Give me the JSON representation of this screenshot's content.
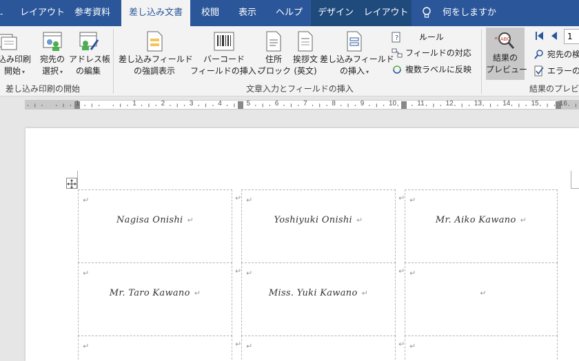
{
  "tabs": {
    "layout1": "レイアウト",
    "references": "参考資料",
    "mailings": "差し込み文書",
    "review": "校閲",
    "view": "表示",
    "help": "ヘルプ",
    "design": "デザイン",
    "layout2": "レイアウト",
    "tell_me": "何をしますか"
  },
  "ribbon": {
    "start_merge": {
      "line1": "込み印刷",
      "line2": "開始"
    },
    "select_recipients": {
      "line1": "宛先の",
      "line2": "選択"
    },
    "edit_address": {
      "line1": "アドレス帳",
      "line2": "の編集"
    },
    "group_start": "差し込み印刷の開始",
    "highlight_fields": {
      "line1": "差し込みフィールド",
      "line2": "の強調表示"
    },
    "barcode": {
      "line1": "バーコード",
      "line2": "フィールドの挿入"
    },
    "address_block": {
      "line1": "住所",
      "line2": "ブロック"
    },
    "greeting": {
      "line1": "挨拶文",
      "line2": "(英文)"
    },
    "insert_field": {
      "line1": "差し込みフィールド",
      "line2": "の挿入"
    },
    "rules": "ルール",
    "match_fields": "フィールドの対応",
    "update_labels": "複数ラベルに反映",
    "group_write": "文章入力とフィールドの挿入",
    "preview": {
      "line1": "結果の",
      "line2": "プレビュー"
    },
    "record_number": "1",
    "find_recipient": "宛先の検",
    "check_errors": "エラーのチ",
    "group_preview": "結果のプレビュ"
  },
  "ruler_numbers": [
    "1",
    "1",
    "2",
    "3",
    "4",
    "5",
    "6",
    "7",
    "8",
    "9",
    "10",
    "11",
    "12",
    "13",
    "14",
    "15",
    "16",
    "17"
  ],
  "marks": {
    "paragraph": "↵"
  },
  "labels": {
    "r0c0": "Nagisa Onishi",
    "r0c1": "Yoshiyuki Onishi",
    "r0c2": "Mr. Aiko Kawano",
    "r1c0": "Mr. Taro Kawano",
    "r1c1": "Miss. Yuki Kawano",
    "r1c2": ""
  },
  "colors": {
    "title_bar": "#2b579a",
    "ribbon": "#f3f3f3",
    "active_tab_text": "#2b579a"
  }
}
